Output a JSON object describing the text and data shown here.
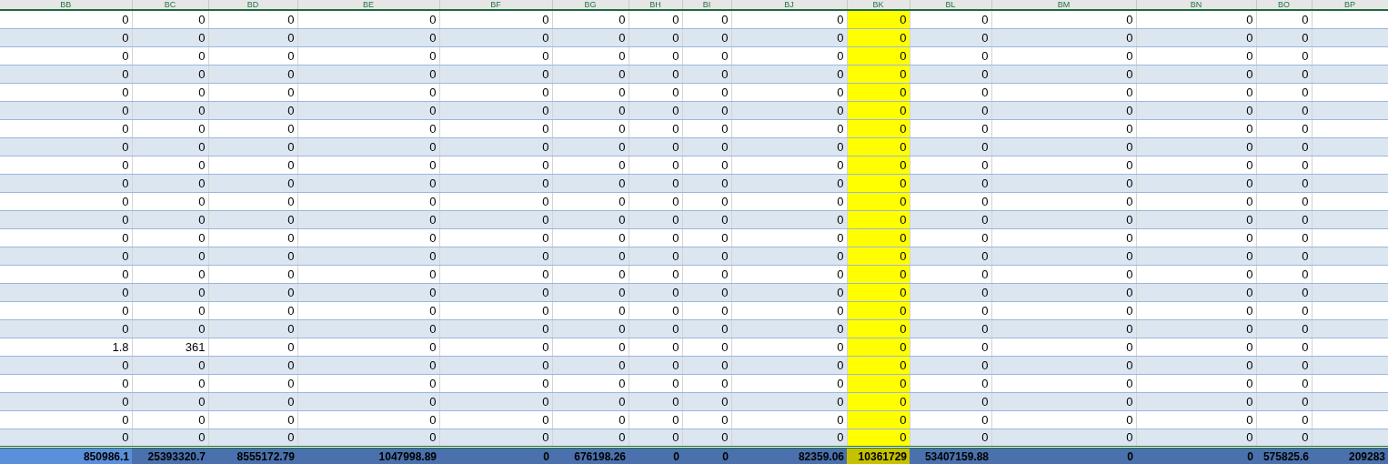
{
  "columns": [
    {
      "label": "BB",
      "highlighted": false
    },
    {
      "label": "BC",
      "highlighted": false
    },
    {
      "label": "BD",
      "highlighted": false
    },
    {
      "label": "BE",
      "highlighted": false
    },
    {
      "label": "BF",
      "highlighted": false
    },
    {
      "label": "BG",
      "highlighted": false
    },
    {
      "label": "BH",
      "highlighted": false
    },
    {
      "label": "BI",
      "highlighted": false
    },
    {
      "label": "BJ",
      "highlighted": false
    },
    {
      "label": "BK",
      "highlighted": true
    },
    {
      "label": "BL",
      "highlighted": false
    },
    {
      "label": "BM",
      "highlighted": false
    },
    {
      "label": "BN",
      "highlighted": false
    },
    {
      "label": "BO",
      "highlighted": false
    },
    {
      "label": "BP"
    }
  ],
  "rows": [
    [
      "0",
      "0",
      "0",
      "0",
      "0",
      "0",
      "0",
      "0",
      "0",
      "0",
      "0",
      "0",
      "0",
      "0"
    ],
    [
      "0",
      "0",
      "0",
      "0",
      "0",
      "0",
      "0",
      "0",
      "0",
      "0",
      "0",
      "0",
      "0",
      "0"
    ],
    [
      "0",
      "0",
      "0",
      "0",
      "0",
      "0",
      "0",
      "0",
      "0",
      "0",
      "0",
      "0",
      "0",
      "0"
    ],
    [
      "0",
      "0",
      "0",
      "0",
      "0",
      "0",
      "0",
      "0",
      "0",
      "0",
      "0",
      "0",
      "0",
      "0"
    ],
    [
      "0",
      "0",
      "0",
      "0",
      "0",
      "0",
      "0",
      "0",
      "0",
      "0",
      "0",
      "0",
      "0",
      "0"
    ],
    [
      "0",
      "0",
      "0",
      "0",
      "0",
      "0",
      "0",
      "0",
      "0",
      "0",
      "0",
      "0",
      "0",
      "0"
    ],
    [
      "0",
      "0",
      "0",
      "0",
      "0",
      "0",
      "0",
      "0",
      "0",
      "0",
      "0",
      "0",
      "0",
      "0"
    ],
    [
      "0",
      "0",
      "0",
      "0",
      "0",
      "0",
      "0",
      "0",
      "0",
      "0",
      "0",
      "0",
      "0",
      "0"
    ],
    [
      "0",
      "0",
      "0",
      "0",
      "0",
      "0",
      "0",
      "0",
      "0",
      "0",
      "0",
      "0",
      "0",
      "0"
    ],
    [
      "0",
      "0",
      "0",
      "0",
      "0",
      "0",
      "0",
      "0",
      "0",
      "0",
      "0",
      "0",
      "0",
      "0"
    ],
    [
      "0",
      "0",
      "0",
      "0",
      "0",
      "0",
      "0",
      "0",
      "0",
      "0",
      "0",
      "0",
      "0",
      "0"
    ],
    [
      "0",
      "0",
      "0",
      "0",
      "0",
      "0",
      "0",
      "0",
      "0",
      "0",
      "0",
      "0",
      "0",
      "0"
    ],
    [
      "0",
      "0",
      "0",
      "0",
      "0",
      "0",
      "0",
      "0",
      "0",
      "0",
      "0",
      "0",
      "0",
      "0"
    ],
    [
      "0",
      "0",
      "0",
      "0",
      "0",
      "0",
      "0",
      "0",
      "0",
      "0",
      "0",
      "0",
      "0",
      "0"
    ],
    [
      "0",
      "0",
      "0",
      "0",
      "0",
      "0",
      "0",
      "0",
      "0",
      "0",
      "0",
      "0",
      "0",
      "0"
    ],
    [
      "0",
      "0",
      "0",
      "0",
      "0",
      "0",
      "0",
      "0",
      "0",
      "0",
      "0",
      "0",
      "0",
      "0"
    ],
    [
      "0",
      "0",
      "0",
      "0",
      "0",
      "0",
      "0",
      "0",
      "0",
      "0",
      "0",
      "0",
      "0",
      "0"
    ],
    [
      "0",
      "0",
      "0",
      "0",
      "0",
      "0",
      "0",
      "0",
      "0",
      "0",
      "0",
      "0",
      "0",
      "0"
    ],
    [
      "1.8",
      "361",
      "0",
      "0",
      "0",
      "0",
      "0",
      "0",
      "0",
      "0",
      "0",
      "0",
      "0",
      "0"
    ],
    [
      "0",
      "0",
      "0",
      "0",
      "0",
      "0",
      "0",
      "0",
      "0",
      "0",
      "0",
      "0",
      "0",
      "0"
    ],
    [
      "0",
      "0",
      "0",
      "0",
      "0",
      "0",
      "0",
      "0",
      "0",
      "0",
      "0",
      "0",
      "0",
      "0"
    ],
    [
      "0",
      "0",
      "0",
      "0",
      "0",
      "0",
      "0",
      "0",
      "0",
      "0",
      "0",
      "0",
      "0",
      "0"
    ],
    [
      "0",
      "0",
      "0",
      "0",
      "0",
      "0",
      "0",
      "0",
      "0",
      "0",
      "0",
      "0",
      "0",
      "0"
    ],
    [
      "0",
      "0",
      "0",
      "0",
      "0",
      "0",
      "0",
      "0",
      "0",
      "0",
      "0",
      "0",
      "0",
      "0"
    ]
  ],
  "totals": [
    {
      "value": "850986.1",
      "color": "#5b8fdb"
    },
    {
      "value": "25393320.7",
      "color": "#4a71ad"
    },
    {
      "value": "8555172.79",
      "color": "#4a71ad"
    },
    {
      "value": "1047998.89",
      "color": "#4a71ad"
    },
    {
      "value": "0",
      "color": "#4a71ad"
    },
    {
      "value": "676198.26",
      "color": "#4a71ad"
    },
    {
      "value": "0",
      "color": "#4a71ad"
    },
    {
      "value": "0",
      "color": "#4a71ad"
    },
    {
      "value": "82359.06",
      "color": "#4a71ad"
    },
    {
      "value": "10361729",
      "color": "#c5c000"
    },
    {
      "value": "53407159.88",
      "color": "#4a71ad"
    },
    {
      "value": "0",
      "color": "#4a71ad"
    },
    {
      "value": "0",
      "color": "#4a71ad"
    },
    {
      "value": "575825.6",
      "color": "#4a71ad"
    },
    {
      "value": "209283",
      "color": "#4a71ad"
    }
  ]
}
